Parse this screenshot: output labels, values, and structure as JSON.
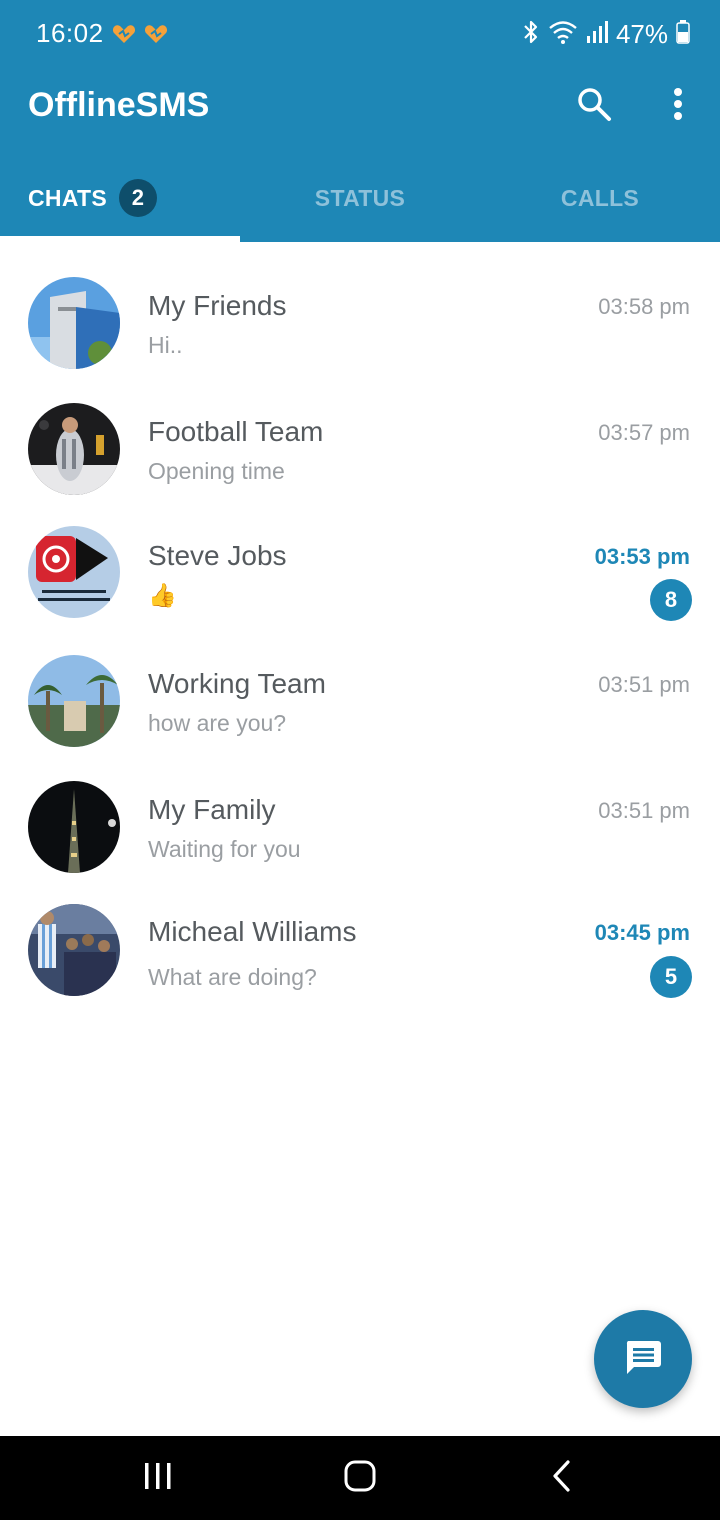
{
  "status_bar": {
    "time": "16:02",
    "battery": "47%",
    "icons": [
      "notification-heart-icon",
      "notification-heart-icon",
      "bluetooth-icon",
      "wifi-icon",
      "signal-icon",
      "battery-icon"
    ]
  },
  "app": {
    "title": "OfflineSMS",
    "accent_color": "#1e87b6"
  },
  "tabs": [
    {
      "label": "CHATS",
      "badge": "2",
      "active": true
    },
    {
      "label": "STATUS",
      "active": false
    },
    {
      "label": "CALLS",
      "active": false
    }
  ],
  "chats": [
    {
      "name": "My Friends",
      "message": "Hi..",
      "time": "03:58 pm",
      "unread": false
    },
    {
      "name": "Football Team",
      "message": "Opening time",
      "time": "03:57 pm",
      "unread": false
    },
    {
      "name": "Steve Jobs",
      "message": "👍",
      "time": "03:53 pm",
      "unread": true,
      "unread_count": "8"
    },
    {
      "name": "Working Team",
      "message": "how are you?",
      "time": "03:51 pm",
      "unread": false
    },
    {
      "name": "My Family",
      "message": "Waiting for you",
      "time": "03:51 pm",
      "unread": false
    },
    {
      "name": "Micheal Williams",
      "message": "What are doing?",
      "time": "03:45 pm",
      "unread": true,
      "unread_count": "5"
    }
  ],
  "fab": {
    "icon": "new-message-icon"
  },
  "nav_bar": {
    "icons": [
      "recent-apps-icon",
      "home-icon",
      "back-icon"
    ]
  }
}
